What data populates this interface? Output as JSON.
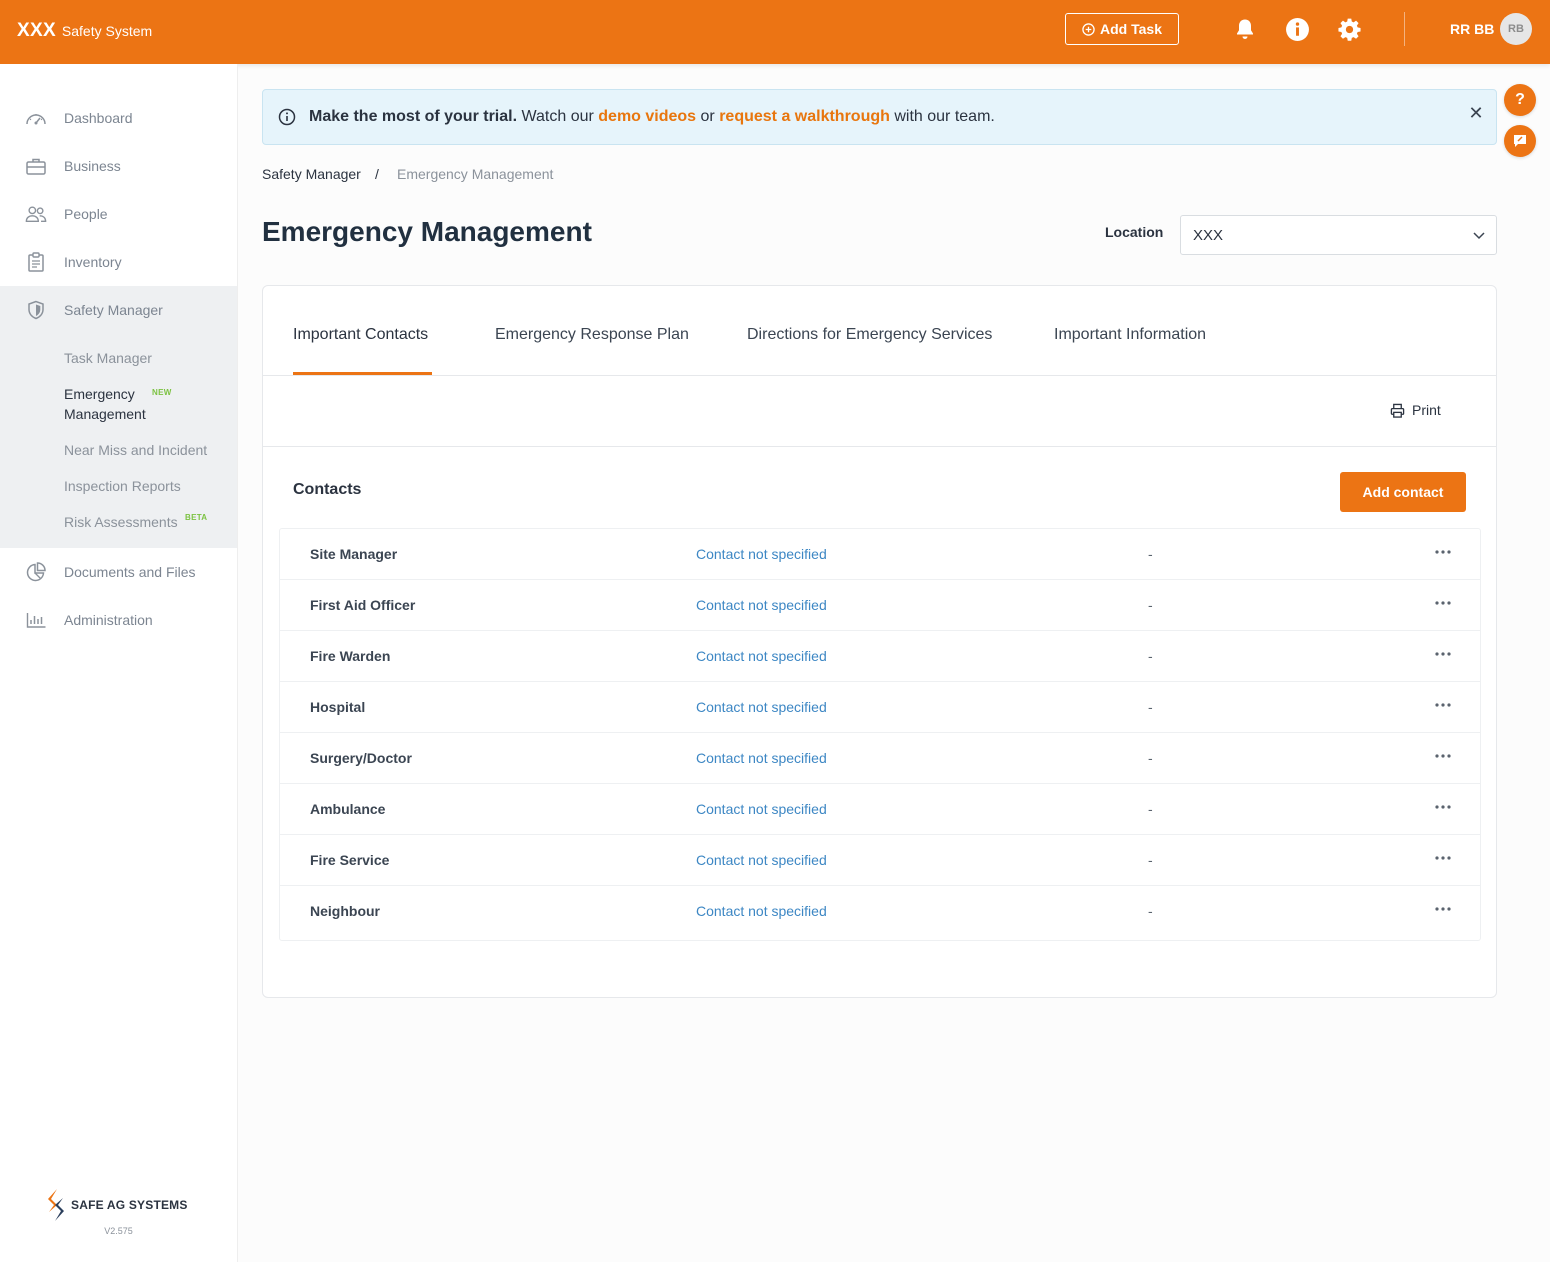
{
  "header": {
    "brand_main": "XXX",
    "brand_sub": "Safety System",
    "add_task_label": "Add Task",
    "user_initials_text": "RR BB",
    "avatar_initials": "RB",
    "icons": [
      "bell-icon",
      "info-icon",
      "gear-icon"
    ],
    "accent": "#ec7414"
  },
  "sidebar": {
    "items": [
      {
        "label": "Dashboard",
        "icon": "dashboard-gauge-icon"
      },
      {
        "label": "Business",
        "icon": "briefcase-icon"
      },
      {
        "label": "People",
        "icon": "people-icon"
      },
      {
        "label": "Inventory",
        "icon": "clipboard-icon"
      },
      {
        "label": "Safety Manager",
        "icon": "shield-icon"
      },
      {
        "label": "Documents and Files",
        "icon": "pie-chart-icon"
      },
      {
        "label": "Administration",
        "icon": "bar-chart-icon"
      }
    ],
    "safety_sub": {
      "task_manager": "Task Manager",
      "emergency_line1": "Emergency",
      "emergency_line2": "Management",
      "emergency_tag": "NEW",
      "near_miss": "Near Miss and Incident",
      "inspection": "Inspection Reports",
      "risk": "Risk Assessments",
      "risk_tag": "BETA"
    },
    "logo_text": "SAFE AG SYSTEMS",
    "version": "V2.575"
  },
  "banner": {
    "lead": "Make the most of your trial.",
    "text1": " Watch our ",
    "link1": "demo videos",
    "text2": " or ",
    "link2": "request a walkthrough",
    "text3": " with our team.",
    "close": "✕"
  },
  "breadcrumb": {
    "parent": "Safety Manager",
    "separator": "/",
    "current": "Emergency Management"
  },
  "page": {
    "title": "Emergency Management",
    "location_label": "Location",
    "location_value": "XXX"
  },
  "tabs": [
    {
      "label": "Important Contacts",
      "active": true
    },
    {
      "label": "Emergency Response Plan",
      "active": false
    },
    {
      "label": "Directions for Emergency Services",
      "active": false
    },
    {
      "label": "Important Information",
      "active": false
    }
  ],
  "toolbar": {
    "print_label": "Print"
  },
  "contacts": {
    "title": "Contacts",
    "add_label": "Add contact",
    "rows": [
      {
        "role": "Site Manager",
        "contact": "Contact not specified",
        "detail": "-"
      },
      {
        "role": "First Aid Officer",
        "contact": "Contact not specified",
        "detail": "-"
      },
      {
        "role": "Fire Warden",
        "contact": "Contact not specified",
        "detail": "-"
      },
      {
        "role": "Hospital",
        "contact": "Contact not specified",
        "detail": "-"
      },
      {
        "role": "Surgery/Doctor",
        "contact": "Contact not specified",
        "detail": "-"
      },
      {
        "role": "Ambulance",
        "contact": "Contact not specified",
        "detail": "-"
      },
      {
        "role": "Fire Service",
        "contact": "Contact not specified",
        "detail": "-"
      },
      {
        "role": "Neighbour",
        "contact": "Contact not specified",
        "detail": "-"
      }
    ]
  }
}
